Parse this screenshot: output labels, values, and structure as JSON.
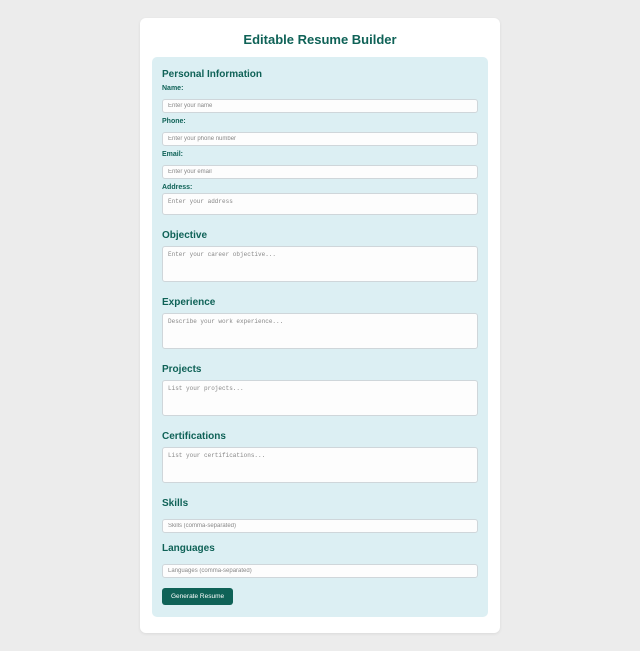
{
  "title": "Editable Resume Builder",
  "sections": {
    "personal": {
      "heading": "Personal Information",
      "name_label": "Name:",
      "name_placeholder": "Enter your name",
      "phone_label": "Phone:",
      "phone_placeholder": "Enter your phone number",
      "email_label": "Email:",
      "email_placeholder": "Enter your email",
      "address_label": "Address:",
      "address_placeholder": "Enter your address"
    },
    "objective": {
      "heading": "Objective",
      "placeholder": "Enter your career objective..."
    },
    "experience": {
      "heading": "Experience",
      "placeholder": "Describe your work experience..."
    },
    "projects": {
      "heading": "Projects",
      "placeholder": "List your projects..."
    },
    "certifications": {
      "heading": "Certifications",
      "placeholder": "List your certifications..."
    },
    "skills": {
      "heading": "Skills",
      "placeholder": "Skills (comma-separated)"
    },
    "languages": {
      "heading": "Languages",
      "placeholder": "Languages (comma-separated)"
    }
  },
  "button": "Generate Resume"
}
